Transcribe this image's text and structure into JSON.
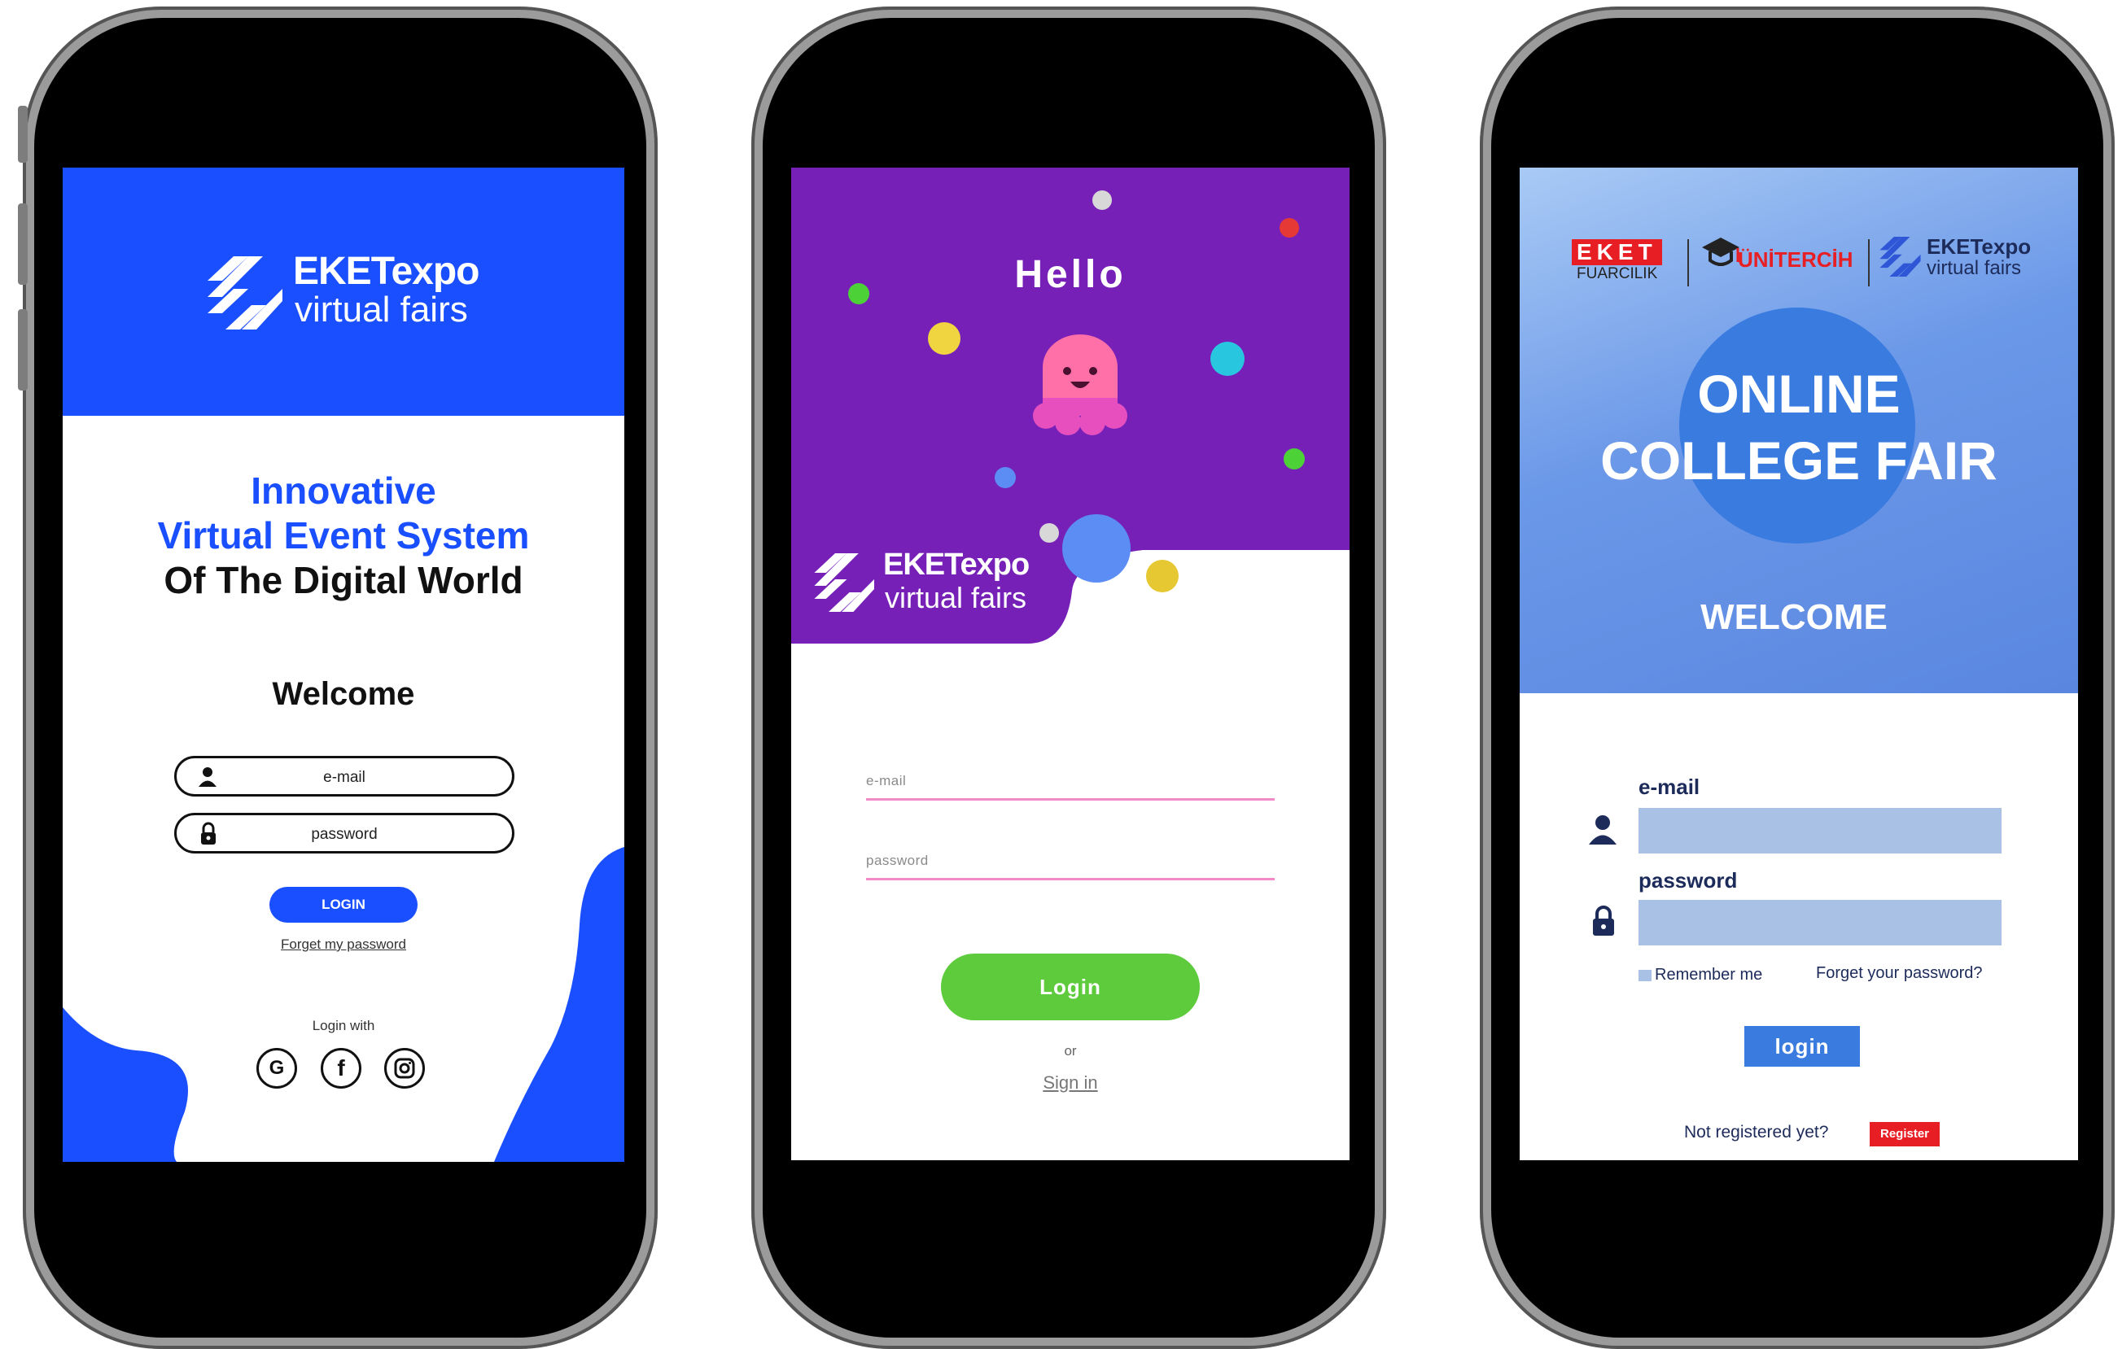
{
  "colors": {
    "blue_brand": "#1a4fff",
    "purple": "#7620b8",
    "green_button": "#5dcb3c",
    "pink_line": "#f28ac7",
    "college_blue": "#3a7be0",
    "register_red": "#e81e25"
  },
  "phone1": {
    "logo_brand": "EKETexpo",
    "logo_sub": "virtual fairs",
    "headline_line1": "Innovative",
    "headline_line2": "Virtual Event System",
    "headline_line3": "Of The Digital World",
    "welcome": "Welcome",
    "email_placeholder": "e-mail",
    "password_placeholder": "password",
    "login_button": "LOGIN",
    "forgot_link": "Forget my password",
    "login_with": "Login with",
    "social_icons": [
      "google-icon",
      "facebook-icon",
      "instagram-icon"
    ]
  },
  "phone2": {
    "greeting": "Hello",
    "logo_brand": "EKETexpo",
    "logo_sub": "virtual fairs",
    "email_label": "e-mail",
    "password_label": "password",
    "login_button": "Login",
    "or_text": "or",
    "signin_link": "Sign in"
  },
  "phone3": {
    "brand1_top": "EKET",
    "brand1_bottom": "FUARCILIK",
    "brand2": "ÜNİTERCİH",
    "brand3_top": "EKETexpo",
    "brand3_bottom": "virtual fairs",
    "title_line1": "ONLINE",
    "title_line2": "COLLEGE FAIR",
    "welcome": "WELCOME",
    "email_label": "e-mail",
    "password_label": "password",
    "remember_me": "Remember me",
    "forgot_link": "Forget your password?",
    "login_button": "login",
    "not_registered": "Not registered yet?",
    "register_button": "Register"
  }
}
